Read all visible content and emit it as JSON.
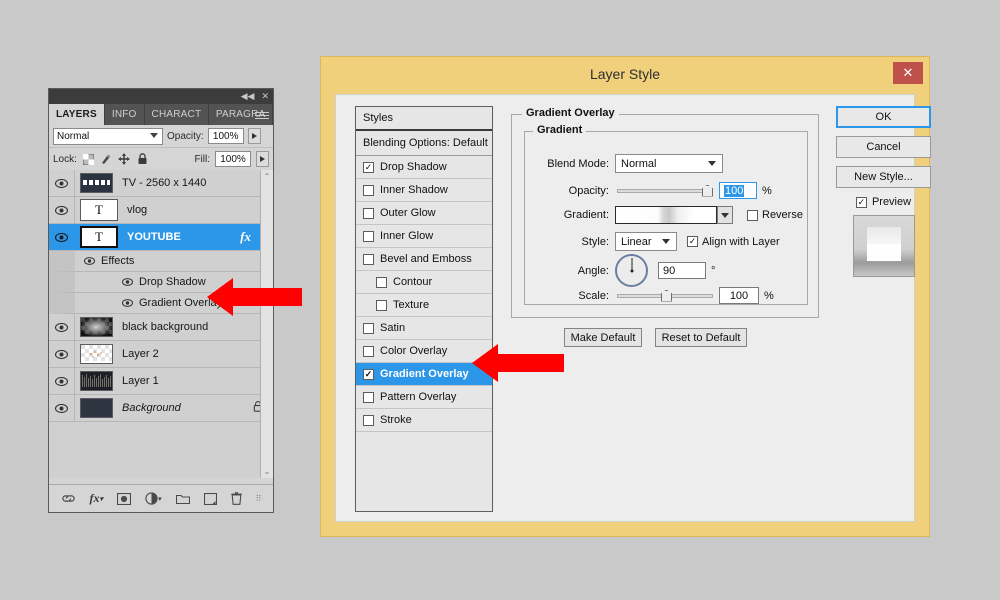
{
  "layers_panel": {
    "titlebar": {
      "collapse_icon": "collapse-icon",
      "close_icon": "close-icon"
    },
    "tabs": [
      {
        "label": "LAYERS",
        "active": true
      },
      {
        "label": "INFO",
        "active": false
      },
      {
        "label": "CHARACT",
        "active": false
      },
      {
        "label": "PARAGRA",
        "active": false
      }
    ],
    "blend": {
      "mode": "Normal",
      "opacity_label": "Opacity:",
      "opacity_value": "100%"
    },
    "lock": {
      "label": "Lock:",
      "fill_label": "Fill:",
      "fill_value": "100%"
    },
    "layers": [
      {
        "name": "TV - 2560 x 1440",
        "thumb": "image",
        "selected": false,
        "italic": false
      },
      {
        "name": "vlog",
        "thumb": "text",
        "selected": false,
        "italic": false
      },
      {
        "name": "YOUTUBE",
        "thumb": "text",
        "selected": true,
        "italic": false,
        "fx": "fx"
      }
    ],
    "effects": {
      "label": "Effects",
      "items": [
        "Drop Shadow",
        "Gradient Overlay"
      ]
    },
    "layers_lower": [
      {
        "name": "black background",
        "thumb": "checker-glow",
        "italic": false
      },
      {
        "name": "Layer 2",
        "thumb": "checker-dots",
        "italic": false
      },
      {
        "name": "Layer 1",
        "thumb": "texture",
        "italic": false
      },
      {
        "name": "Background",
        "thumb": "solid-dark",
        "italic": true,
        "locked": true
      }
    ],
    "footer_icons": [
      "link-icon",
      "fx-icon",
      "mask-icon",
      "adjustment-icon",
      "group-icon",
      "new-layer-icon",
      "delete-icon"
    ]
  },
  "dialog": {
    "title": "Layer Style",
    "close_icon": "close-icon",
    "styles_list": {
      "header": "Styles",
      "blending_options": "Blending Options: Default",
      "items": [
        {
          "label": "Drop Shadow",
          "checked": true,
          "nested": false,
          "active": false
        },
        {
          "label": "Inner Shadow",
          "checked": false,
          "nested": false,
          "active": false
        },
        {
          "label": "Outer Glow",
          "checked": false,
          "nested": false,
          "active": false
        },
        {
          "label": "Inner Glow",
          "checked": false,
          "nested": false,
          "active": false
        },
        {
          "label": "Bevel and Emboss",
          "checked": false,
          "nested": false,
          "active": false
        },
        {
          "label": "Contour",
          "checked": false,
          "nested": true,
          "active": false
        },
        {
          "label": "Texture",
          "checked": false,
          "nested": true,
          "active": false
        },
        {
          "label": "Satin",
          "checked": false,
          "nested": false,
          "active": false
        },
        {
          "label": "Color Overlay",
          "checked": false,
          "nested": false,
          "active": false
        },
        {
          "label": "Gradient Overlay",
          "checked": true,
          "nested": false,
          "active": true
        },
        {
          "label": "Pattern Overlay",
          "checked": false,
          "nested": false,
          "active": false
        },
        {
          "label": "Stroke",
          "checked": false,
          "nested": false,
          "active": false
        }
      ]
    },
    "settings": {
      "group_title": "Gradient Overlay",
      "subgroup_title": "Gradient",
      "blend_mode_label": "Blend Mode:",
      "blend_mode_value": "Normal",
      "opacity_label": "Opacity:",
      "opacity_value": "100",
      "opacity_unit": "%",
      "gradient_label": "Gradient:",
      "reverse_label": "Reverse",
      "reverse_checked": false,
      "style_label": "Style:",
      "style_value": "Linear",
      "align_label": "Align with Layer",
      "align_checked": true,
      "angle_label": "Angle:",
      "angle_value": "90",
      "angle_unit": "°",
      "scale_label": "Scale:",
      "scale_value": "100",
      "scale_unit": "%",
      "make_default": "Make Default",
      "reset_default": "Reset to Default"
    },
    "buttons": {
      "ok": "OK",
      "cancel": "Cancel",
      "new_style": "New Style...",
      "preview_label": "Preview",
      "preview_checked": true
    }
  },
  "annotations": {
    "arrow_1_target": "Gradient Overlay effect in layers panel",
    "arrow_2_target": "Gradient Overlay item in styles list",
    "arrow_color": "#ff0000"
  },
  "colors": {
    "page_background": "#c9c9c9",
    "dialog_frame": "#f0d07a",
    "selection_blue": "#2c97e8",
    "close_button": "#c0504a"
  }
}
